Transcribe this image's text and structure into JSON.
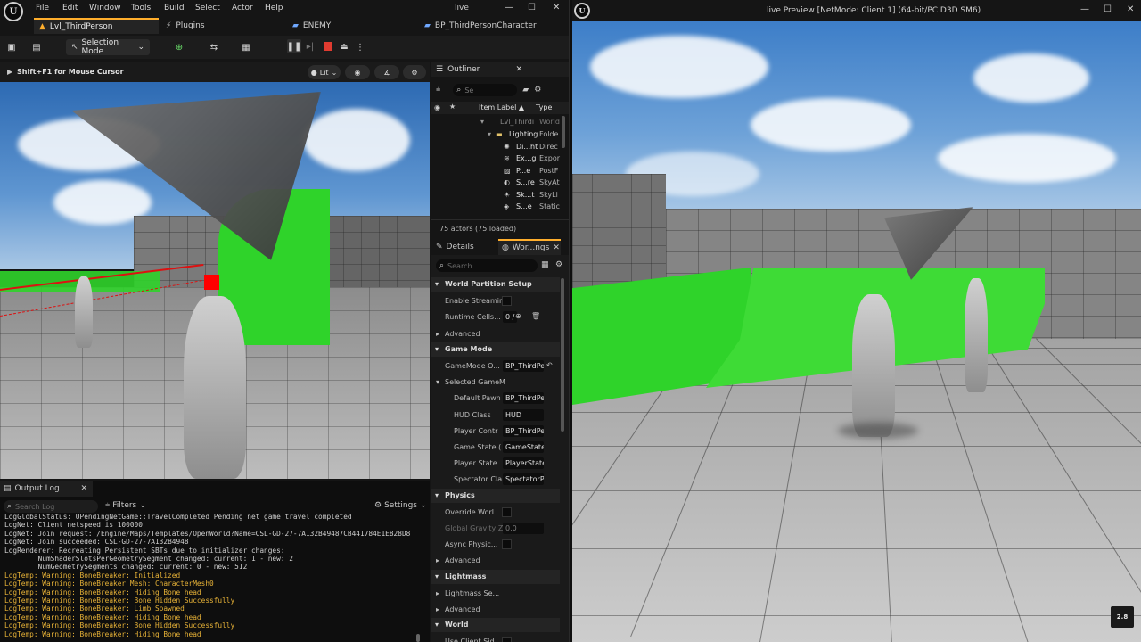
{
  "editor": {
    "menu": [
      "File",
      "Edit",
      "Window",
      "Tools",
      "Build",
      "Select",
      "Actor",
      "Help"
    ],
    "window_title": "live",
    "tabs": [
      "Lvl_ThirdPerson",
      "Plugins",
      "ENEMY",
      "BP_ThirdPersonCharacter"
    ],
    "toolbar": {
      "selection_mode": "Selection Mode"
    },
    "viewport": {
      "hint": "Shift+F1 for Mouse Cursor",
      "lit_label": "Lit"
    }
  },
  "outliner": {
    "title": "Outliner",
    "search_placeholder": "Se",
    "col_label": "Item Label ▲",
    "col_type": "Type",
    "items": [
      {
        "name": "Lvl_Thirdi",
        "type": "World"
      },
      {
        "name": "Lighting",
        "type": "Folde"
      },
      {
        "name": "Di...ht",
        "type": "Direc"
      },
      {
        "name": "Ex...g",
        "type": "Expor"
      },
      {
        "name": "P...e",
        "type": "PostF"
      },
      {
        "name": "S...re",
        "type": "SkyAt"
      },
      {
        "name": "Sk...t",
        "type": "SkyLi"
      },
      {
        "name": "S...e",
        "type": "Static"
      }
    ],
    "actor_count": "75 actors (75 loaded)"
  },
  "details": {
    "tab1": "Details",
    "tab2": "Wor...ngs",
    "search_placeholder": "Search",
    "rows": [
      {
        "kind": "section",
        "label": "World Partition Setup"
      },
      {
        "kind": "check",
        "label": "Enable Streamin"
      },
      {
        "kind": "value",
        "label": "Runtime Cells...",
        "value": "0 /"
      },
      {
        "kind": "sub",
        "label": "Advanced"
      },
      {
        "kind": "section",
        "label": "Game Mode"
      },
      {
        "kind": "value",
        "label": "GameMode O...",
        "value": "BP_ThirdPer"
      },
      {
        "kind": "sub",
        "label": "Selected GameM"
      },
      {
        "kind": "value",
        "label": "Default Pawn",
        "value": "BP_ThirdPer",
        "indent": true
      },
      {
        "kind": "value",
        "label": "HUD Class",
        "value": "HUD",
        "indent": true
      },
      {
        "kind": "value",
        "label": "Player Contr",
        "value": "BP_ThirdPer",
        "indent": true
      },
      {
        "kind": "value",
        "label": "Game State (",
        "value": "GameStateE",
        "indent": true
      },
      {
        "kind": "value",
        "label": "Player State",
        "value": "PlayerState",
        "indent": true
      },
      {
        "kind": "value",
        "label": "Spectator Cla",
        "value": "SpectatorPa",
        "indent": true
      },
      {
        "kind": "section",
        "label": "Physics"
      },
      {
        "kind": "check",
        "label": "Override Worl..."
      },
      {
        "kind": "value",
        "label": "Global Gravity Z",
        "value": "0.0",
        "dim": true
      },
      {
        "kind": "check",
        "label": "Async Physic..."
      },
      {
        "kind": "sub",
        "label": "Advanced"
      },
      {
        "kind": "section",
        "label": "Lightmass"
      },
      {
        "kind": "sub",
        "label": "Lightmass Se..."
      },
      {
        "kind": "sub",
        "label": "Advanced"
      },
      {
        "kind": "section",
        "label": "World"
      },
      {
        "kind": "check",
        "label": "Use Client Sid"
      }
    ]
  },
  "output_log": {
    "title": "Output Log",
    "search_placeholder": "Search Log",
    "filters_label": "Filters",
    "settings_label": "Settings",
    "lines": [
      {
        "t": "LogGlobalStatus: UPendingNetGame::TravelCompleted Pending net game travel completed",
        "w": false
      },
      {
        "t": "LogNet: Client netspeed is 100000",
        "w": false
      },
      {
        "t": "LogNet: Join request: /Engine/Maps/Templates/OpenWorld?Name=CSL-GD-27-7A132B49487CB441784E1E828D8",
        "w": false
      },
      {
        "t": "LogNet: Join succeeded: CSL-GD-27-7A132B4948",
        "w": false
      },
      {
        "t": "LogRenderer: Recreating Persistent SBTs due to initializer changes:",
        "w": false
      },
      {
        "t": "        NumShaderSlotsPerGeometrySegment changed: current: 1 - new: 2",
        "w": false
      },
      {
        "t": "        NumGeometrySegments changed: current: 0 - new: 512",
        "w": false
      },
      {
        "t": "LogTemp: Warning: BoneBreaker: Initialized",
        "w": true
      },
      {
        "t": "LogTemp: Warning: BoneBreaker Mesh: CharacterMesh0",
        "w": true
      },
      {
        "t": "LogTemp: Warning: BoneBreaker: Hiding Bone head",
        "w": true
      },
      {
        "t": "LogTemp: Warning: BoneBreaker: Bone Hidden Successfully",
        "w": true
      },
      {
        "t": "LogTemp: Warning: BoneBreaker: Limb Spawned",
        "w": true
      },
      {
        "t": "LogTemp: Warning: BoneBreaker: Hiding Bone head",
        "w": true
      },
      {
        "t": "LogTemp: Warning: BoneBreaker: Bone Hidden Successfully",
        "w": true
      },
      {
        "t": "LogTemp: Warning: BoneBreaker: Hiding Bone head",
        "w": true
      }
    ]
  },
  "preview": {
    "title": "live Preview [NetMode: Client 1]  (64-bit/PC D3D SM6)",
    "watermark": "2.8"
  },
  "colors": {
    "accent": "#ffae2c",
    "green_geometry": "#2fd32a",
    "warning": "#e7b237",
    "stop": "#e03b30"
  }
}
